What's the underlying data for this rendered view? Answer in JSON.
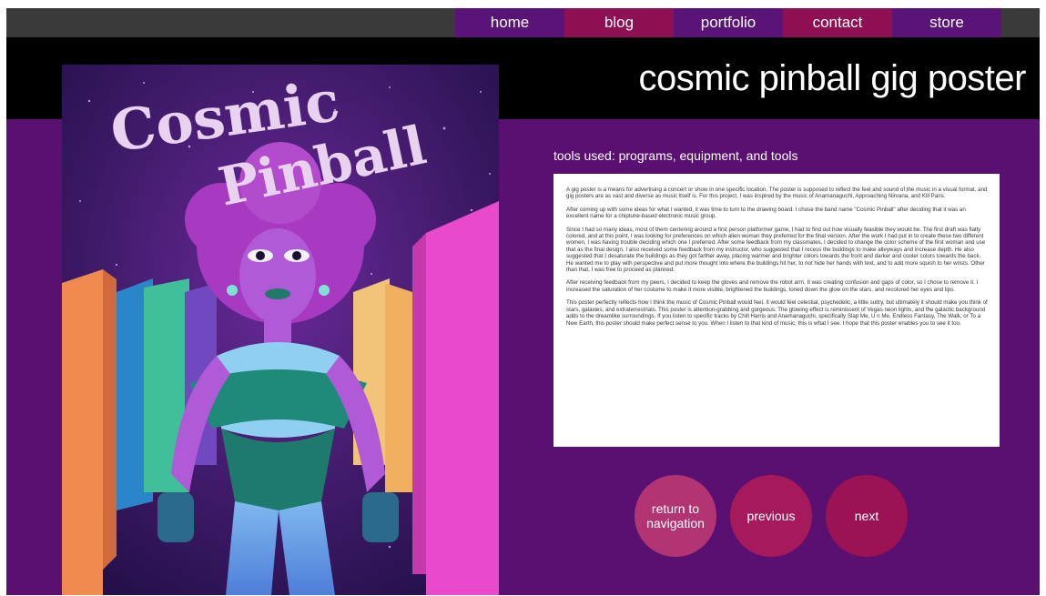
{
  "nav": {
    "items": [
      "home",
      "blog",
      "portfolio",
      "contact",
      "store"
    ]
  },
  "page": {
    "title": "cosmic pinball gig poster"
  },
  "poster": {
    "lettering": "Cosmic Pinball",
    "alt": "Cosmic Pinball poster illustration"
  },
  "section": {
    "heading": "tools used: programs, equipment, and tools"
  },
  "article": {
    "paragraphs": [
      "A gig poster is a means for advertising a concert or show in one specific location. The poster is supposed to reflect the feel and sound of the music in a visual format, and gig posters are as vast and diverse as music itself is. For this project, I was inspired by the music of Anamanaguchi, Approaching Nirvana, and Kill Paris.",
      "After coming up with some ideas for what I wanted, it was time to turn to the drawing board. I chose the band name \"Cosmic Pinball\" after deciding that it was an excellent name for a chiptune-based electronic music group.",
      "Since I had so many ideas, most of them centering around a first person platformer game, I had to find out how visually feasible they would be. The first draft was flatly colored, and at this point, I was looking for preferences on which alien woman they preferred for the final version. After the work I had put in to create these two different women, I was having trouble deciding which one I preferred. After some feedback from my classmates, I decided to change the color scheme of the first woman and use that as the final design. I also received some feedback from my instructor, who suggested that I recess the buildings to make alleyways and increase depth. He also suggested that I desaturate the buildings as they got farther away, placing warmer and brighter colors towards the front and darker and cooler colors towards the back. He wanted me to play with perspective and put more thought into where the buildings hit her, to not hide her hands with text, and to add more squish to her wrists. Other than that, I was free to proceed as planned.",
      "After receiving feedback from my peers, I decided to keep the gloves and remove the robot arm. It was creating confusion and gaps of color, so I chose to remove it. I increased the saturation of her costume to make it more visible, brightened the buildings, toned down the glow on the stars, and recolored her eyes and lips.",
      "This poster perfectly reflects how I think the music of Cosmic Pinball would feel. It would feel celestial, psychedelic, a little sultry, but ultimately it should make you think of stars, galaxies, and extraterrestrials. This poster is attention-grabbing and gorgeous. The glowing effect is reminiscent of Vegas neon lights, and the galactic background adds to the dreamlike surroundings. If you listen to specific tracks by Chill Harris and Anamanaguchi, specifically Slap Me, U n Me, Endless Fantasy, The Walk, or To a New Earth, this poster should make perfect sense to you. When I listen to that kind of music, this is what I see. I hope that this poster enables you to see it too."
    ]
  },
  "buttons": {
    "return_label": "return to navigation",
    "previous_label": "previous",
    "next_label": "next"
  },
  "colors": {
    "page_bg": "#5a1070",
    "nav_bar": "#3a3a3a",
    "nav_purple": "#5a1478",
    "nav_magenta": "#8f0f55",
    "button_pink": "#b23473"
  }
}
